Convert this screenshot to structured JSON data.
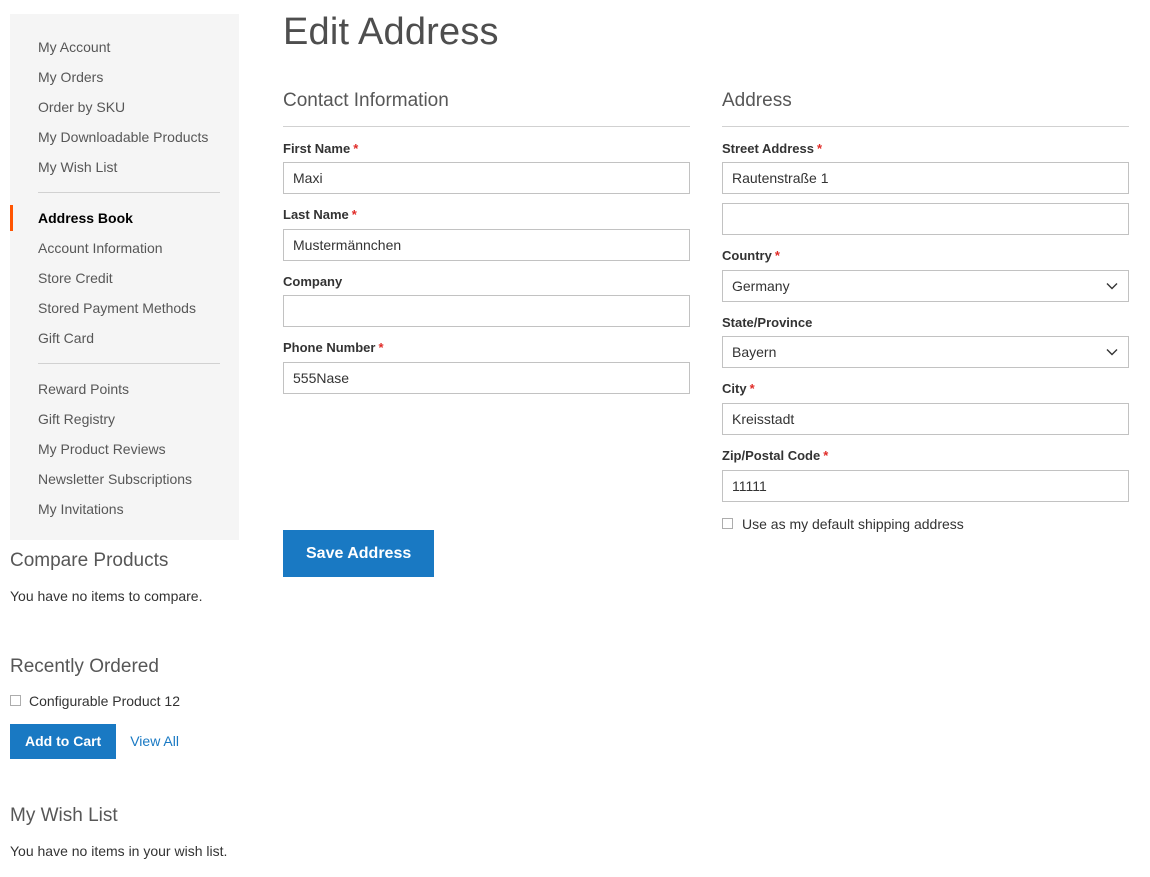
{
  "page": {
    "title": "Edit Address"
  },
  "sidebar": {
    "groups": [
      {
        "items": [
          {
            "label": "My Account",
            "current": false
          },
          {
            "label": "My Orders",
            "current": false
          },
          {
            "label": "Order by SKU",
            "current": false
          },
          {
            "label": "My Downloadable Products",
            "current": false
          },
          {
            "label": "My Wish List",
            "current": false
          }
        ]
      },
      {
        "items": [
          {
            "label": "Address Book",
            "current": true
          },
          {
            "label": "Account Information",
            "current": false
          },
          {
            "label": "Store Credit",
            "current": false
          },
          {
            "label": "Stored Payment Methods",
            "current": false
          },
          {
            "label": "Gift Card",
            "current": false
          }
        ]
      },
      {
        "items": [
          {
            "label": "Reward Points",
            "current": false
          },
          {
            "label": "Gift Registry",
            "current": false
          },
          {
            "label": "My Product Reviews",
            "current": false
          },
          {
            "label": "Newsletter Subscriptions",
            "current": false
          },
          {
            "label": "My Invitations",
            "current": false
          }
        ]
      }
    ]
  },
  "compare_products": {
    "title": "Compare Products",
    "empty_text": "You have no items to compare."
  },
  "recently_ordered": {
    "title": "Recently Ordered",
    "items": [
      {
        "label": "Configurable Product 12",
        "checked": false
      }
    ],
    "add_to_cart_label": "Add to Cart",
    "view_all_label": "View All"
  },
  "wish_list": {
    "title": "My Wish List",
    "empty_text": "You have no items in your wish list."
  },
  "contact_information": {
    "legend": "Contact Information",
    "fields": [
      {
        "label": "First Name",
        "required": true,
        "value": "Maxi"
      },
      {
        "label": "Last Name",
        "required": true,
        "value": "Mustermännchen"
      },
      {
        "label": "Company",
        "required": false,
        "value": ""
      },
      {
        "label": "Phone Number",
        "required": true,
        "value": "555Nase"
      }
    ]
  },
  "address": {
    "legend": "Address",
    "street_label": "Street Address",
    "street_required": true,
    "street_line1": "Rautenstraße 1",
    "street_line2": "",
    "country_label": "Country",
    "country_required": true,
    "country_value": "Germany",
    "state_label": "State/Province",
    "state_required": false,
    "state_value": "Bayern",
    "city_label": "City",
    "city_required": true,
    "city_value": "Kreisstadt",
    "zip_label": "Zip/Postal Code",
    "zip_required": true,
    "zip_value": "11111",
    "default_shipping_label": "Use as my default shipping address",
    "default_shipping_checked": false
  },
  "actions": {
    "save_label": "Save Address"
  },
  "colors": {
    "accent_orange": "#ff5501",
    "primary_blue": "#1979c3",
    "required_red": "#e02b27",
    "sidebar_bg": "#f5f5f5",
    "border_gray": "#c2c2c2"
  },
  "icons": {
    "chevron_down": "chevron-down-icon",
    "checkbox": "checkbox-icon"
  }
}
